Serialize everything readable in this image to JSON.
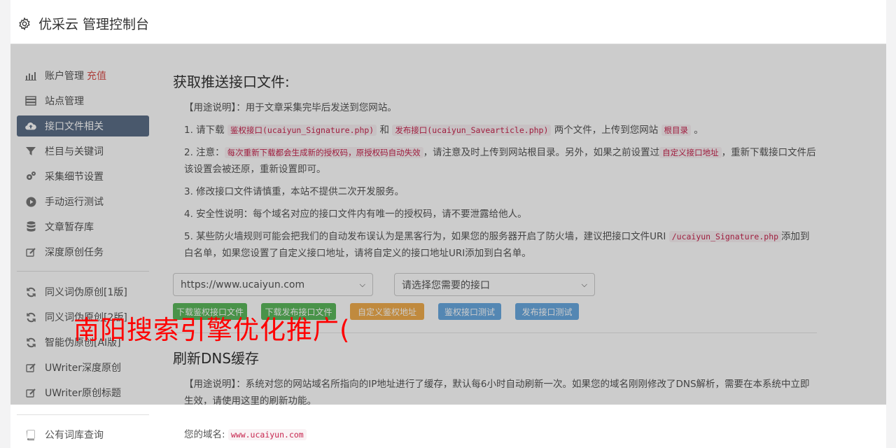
{
  "header": {
    "title": "优采云 管理控制台",
    "icon": "gear-icon"
  },
  "sidebar": {
    "items": [
      {
        "label": "账户管理",
        "tag": "充值",
        "icon": "bar-chart-icon",
        "active": false
      },
      {
        "label": "站点管理",
        "icon": "server-icon",
        "active": false
      },
      {
        "label": "接口文件相关",
        "icon": "cloud-upload-icon",
        "active": true
      },
      {
        "label": "栏目与关键词",
        "icon": "filter-icon",
        "active": false
      },
      {
        "label": "采集细节设置",
        "icon": "gears-icon",
        "active": false
      },
      {
        "label": "手动运行测试",
        "icon": "play-circle-icon",
        "active": false
      },
      {
        "label": "文章暂存库",
        "icon": "database-icon",
        "active": false
      },
      {
        "label": "深度原创任务",
        "icon": "edit-icon",
        "active": false
      }
    ],
    "items2": [
      {
        "label": "同义词伪原创[1版]",
        "icon": "refresh-icon"
      },
      {
        "label": "同义词伪原创[2版]",
        "icon": "refresh-icon"
      },
      {
        "label": "智能伪原创[AI版]",
        "icon": "refresh-icon"
      },
      {
        "label": "UWriter深度原创",
        "icon": "edit-icon"
      },
      {
        "label": "UWriter原创标题",
        "icon": "edit-icon"
      }
    ],
    "items3": [
      {
        "label": "公有词库查询",
        "icon": "book-icon"
      }
    ]
  },
  "section1": {
    "title": "获取推送接口文件:",
    "usage": "【用途说明】：用于文章采集完毕后发送到您网站。",
    "p1_a": "1. 请下载 ",
    "p1_code1": "鉴权接口(ucaiyun_Signature.php)",
    "p1_b": " 和 ",
    "p1_code2": "发布接口(ucaiyun_Savearticle.php)",
    "p1_c": " 两个文件，上传到您网站 ",
    "p1_code3": "根目录",
    "p1_d": " 。",
    "p2_a": "2. 注意：",
    "p2_code1": "每次重新下载都会生成新的授权码，原授权码自动失效",
    "p2_b": "，请注意及时上传到网站根目录。另外，如果之前设置过",
    "p2_code2": "自定义接口地址",
    "p2_c": "，重新下载接口文件后该设置会被还原，重新设置即可。",
    "p3": "3. 修改接口文件请慎重，本站不提供二次开发服务。",
    "p4": "4. 安全性说明：每个域名对应的接口文件内有唯一的授权码，请不要泄露给他人。",
    "p5_a": "5. 某些防火墙规则可能会把我们的自动发布误认为是黑客行为，如果您的服务器开启了防火墙，建议把接口文件URI ",
    "p5_code": "/ucaiyun_Signature.php",
    "p5_b": "添加到白名单，如果您设置了自定义接口地址，请将自定义的接口地址URI添加到白名单。",
    "select_site": "https://www.ucaiyun.com",
    "select_api": "请选择您需要的接口",
    "btn1": "下载鉴权接口文件",
    "btn2": "下载发布接口文件",
    "btn3": "自定义鉴权地址",
    "btn4": "鉴权接口测试",
    "btn5": "发布接口测试"
  },
  "section2": {
    "title": "刷新DNS缓存",
    "usage": "【用途说明】：系统对您的网站域名所指向的IP地址进行了缓存，默认每6小时自动刷新一次。如果您的域名刚刚修改了DNS解析，需要在本系统中立即生效，请使用这里的刷新功能。",
    "domain_label": "您的域名:",
    "domain_value": "www.ucaiyun.com"
  },
  "watermark": "南阳搜索引擎优化推广("
}
